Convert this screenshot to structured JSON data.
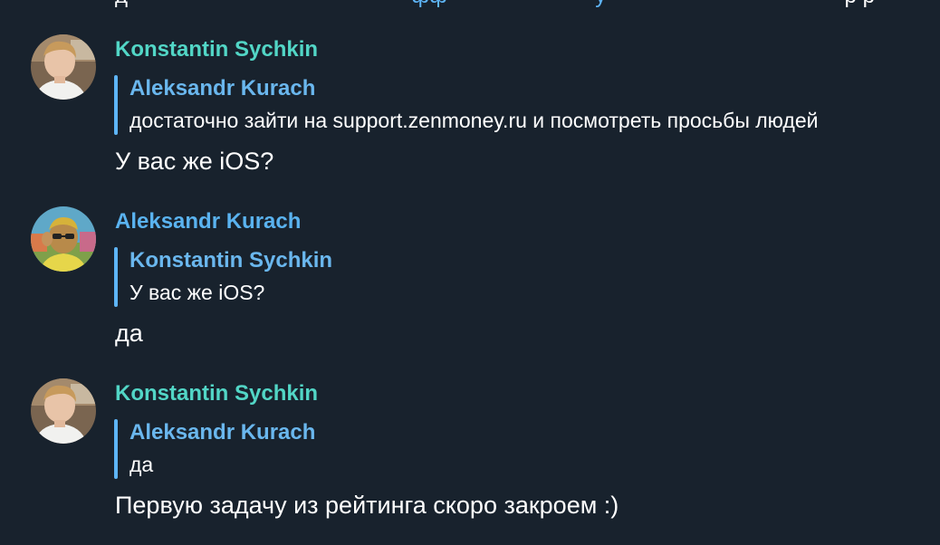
{
  "cut_top": {
    "text_start": "д",
    "link_text": "фф",
    "mid_text": "у",
    "end_text": "р р"
  },
  "messages": [
    {
      "author": "Konstantin Sychkin",
      "reply_author": "Aleksandr Kurach",
      "reply_text": "достаточно зайти на support.zenmoney.ru и посмотреть просьбы людей",
      "text": "У вас же iOS?"
    },
    {
      "author": "Aleksandr Kurach",
      "reply_author": "Konstantin Sychkin",
      "reply_text": "У вас же iOS?",
      "text": "да"
    },
    {
      "author": "Konstantin Sychkin",
      "reply_author": "Aleksandr Kurach",
      "reply_text": "да",
      "text": "Первую задачу из рейтинга скоро закроем :)"
    }
  ],
  "colors": {
    "background": "#18222d",
    "author_teal": "#52d6c6",
    "author_blue": "#5ab3f0",
    "reply_bar": "#5eb5f7"
  }
}
